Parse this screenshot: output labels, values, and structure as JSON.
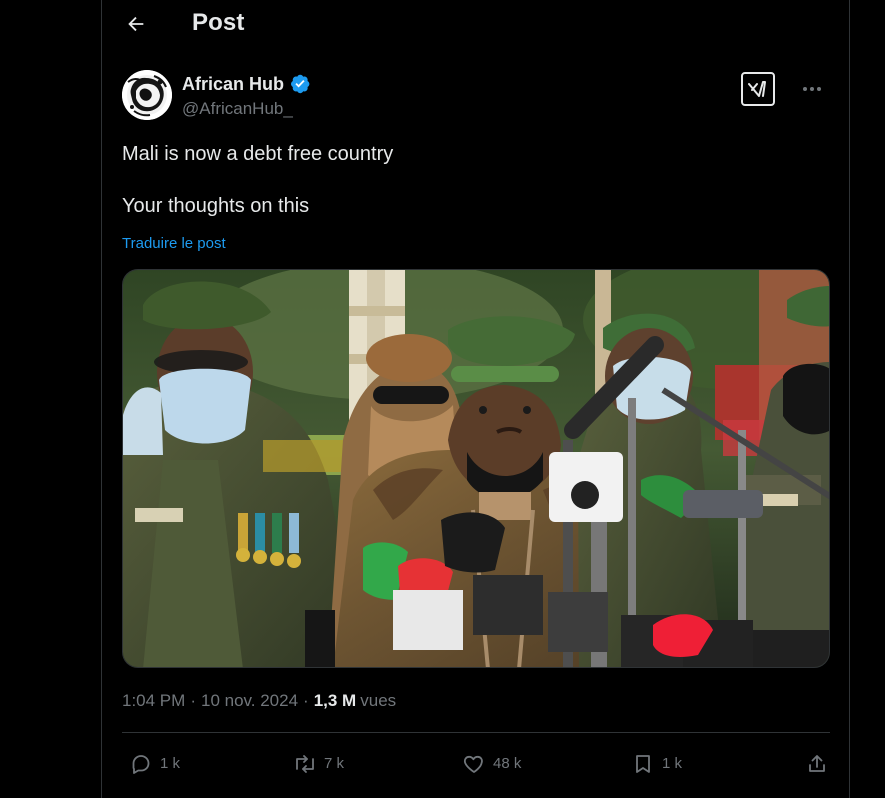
{
  "header": {
    "title": "Post"
  },
  "author": {
    "name": "African Hub",
    "handle": "@AfricanHub_",
    "verified": true,
    "avatar_alt": "African Hub avatar"
  },
  "post": {
    "text": "Mali is now a debt free country\n\nYour thoughts on this",
    "translate_label": "Traduire le post"
  },
  "meta": {
    "time": "1:04 PM",
    "date": "10 nov. 2024",
    "separator": "·",
    "views": "1,3 M",
    "views_label": "vues"
  },
  "actions": {
    "reply_count": "1 k",
    "repost_count": "7 k",
    "like_count": "48 k",
    "bookmark_count": "1 k"
  },
  "icons": {
    "back": "arrow-left-icon",
    "verified": "verified-badge-icon",
    "grok": "grok-icon",
    "more": "more-horizontal-icon",
    "reply": "reply-icon",
    "repost": "repost-icon",
    "like": "heart-icon",
    "bookmark": "bookmark-icon",
    "share": "share-icon"
  },
  "colors": {
    "background": "#000000",
    "text": "#e7e9ea",
    "secondary_text": "#71767b",
    "accent": "#1d9bf0",
    "border": "#2f3336"
  }
}
